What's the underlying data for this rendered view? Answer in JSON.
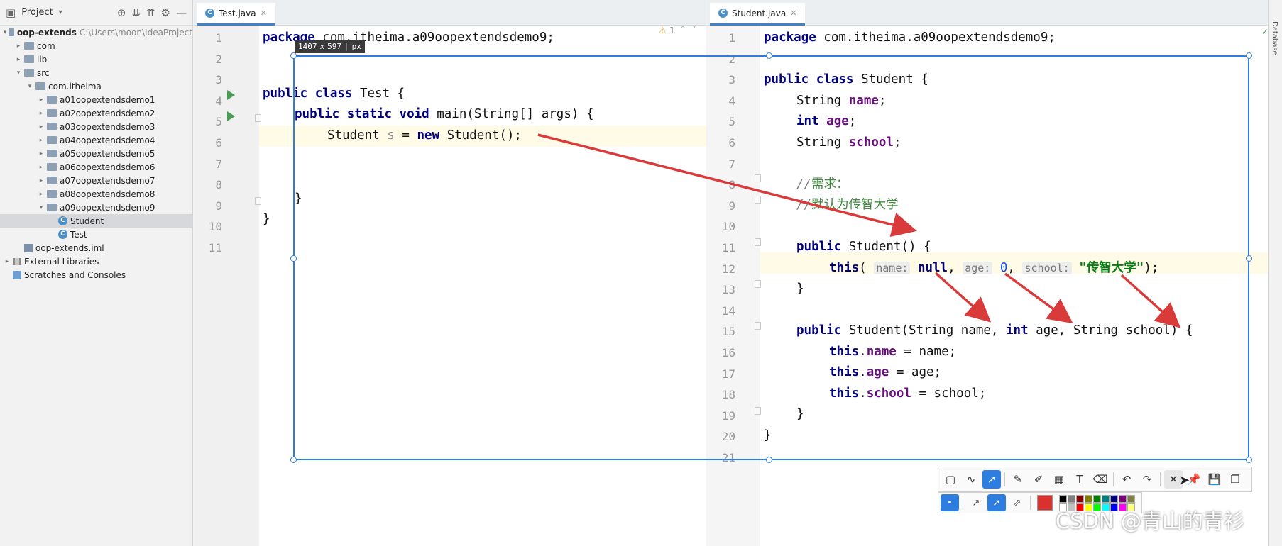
{
  "project": {
    "header_label": "Project",
    "tree": [
      {
        "label": "oop-extends",
        "path": "C:\\Users\\moon\\IdeaProject",
        "kind": "module",
        "depth": 0,
        "expanded": true,
        "bold": true
      },
      {
        "label": "com",
        "kind": "folder",
        "depth": 1,
        "expanded": false
      },
      {
        "label": "lib",
        "kind": "folder",
        "depth": 1,
        "expanded": false
      },
      {
        "label": "src",
        "kind": "folder",
        "depth": 1,
        "expanded": true
      },
      {
        "label": "com.itheima",
        "kind": "folder",
        "depth": 2,
        "expanded": true
      },
      {
        "label": "a01oopextendsdemo1",
        "kind": "folder",
        "depth": 3,
        "expanded": false
      },
      {
        "label": "a02oopextendsdemo2",
        "kind": "folder",
        "depth": 3,
        "expanded": false
      },
      {
        "label": "a03oopextendsdemo3",
        "kind": "folder",
        "depth": 3,
        "expanded": false
      },
      {
        "label": "a04oopextendsdemo4",
        "kind": "folder",
        "depth": 3,
        "expanded": false
      },
      {
        "label": "a05oopextendsdemo5",
        "kind": "folder",
        "depth": 3,
        "expanded": false
      },
      {
        "label": "a06oopextendsdemo6",
        "kind": "folder",
        "depth": 3,
        "expanded": false
      },
      {
        "label": "a07oopextendsdemo7",
        "kind": "folder",
        "depth": 3,
        "expanded": false
      },
      {
        "label": "a08oopextendsdemo8",
        "kind": "folder",
        "depth": 3,
        "expanded": false
      },
      {
        "label": "a09oopextendsdemo9",
        "kind": "folder",
        "depth": 3,
        "expanded": true
      },
      {
        "label": "Student",
        "kind": "class",
        "depth": 4,
        "selected": true
      },
      {
        "label": "Test",
        "kind": "class",
        "depth": 4
      },
      {
        "label": "oop-extends.iml",
        "kind": "iml",
        "depth": 1
      },
      {
        "label": "External Libraries",
        "kind": "libs",
        "depth": 0,
        "expanded": false
      },
      {
        "label": "Scratches and Consoles",
        "kind": "scratch",
        "depth": 0
      }
    ]
  },
  "left_editor": {
    "tab": "Test.java",
    "warning_count": "1",
    "line_numbers": [
      "1",
      "2",
      "3",
      "4",
      "5",
      "6",
      "7",
      "8",
      "9",
      "10",
      "11"
    ]
  },
  "right_editor": {
    "tab": "Student.java",
    "line_numbers": [
      "1",
      "2",
      "3",
      "4",
      "5",
      "6",
      "7",
      "8",
      "9",
      "10",
      "11",
      "12",
      "13",
      "14",
      "15",
      "16",
      "17",
      "18",
      "19",
      "20",
      "21"
    ]
  },
  "code_text": {
    "package_kw": "package",
    "package_name": " com.itheima.a09oopextendsdemo9;",
    "public": "public",
    "class": "class",
    "static": "static",
    "void": "void",
    "test_class": " Test {",
    "main_sig": " main(String[] args) {",
    "student_type": "Student ",
    "var_s": "s",
    "assign": " = ",
    "new": "new",
    "ctor_call": " Student();",
    "close_brace": "}",
    "student_class": " Student {",
    "string_type": "String ",
    "int": "int",
    "name": "name",
    "age": "age",
    "school": "school",
    "semi": ";",
    "comment1_slashes": "//",
    "comment1_text": "需求：",
    "comment2_slashes": "//",
    "comment2_text": "默认为传智大学",
    "ctor_noarg": " Student() {",
    "this": "this",
    "paren_open": "(",
    "hint_name": "name:",
    "null": "null",
    "comma": ", ",
    "hint_age": "age:",
    "zero": "0",
    "hint_school": "school:",
    "school_value": "\"传智大学\"",
    "paren_close_semi": ");",
    "ctor_full_a": " Student(String name, ",
    "ctor_full_b": " age, String school) {",
    "dot": ".",
    "assign_name": " = name;",
    "assign_age": " = age;",
    "assign_school": " = school;"
  },
  "capture": {
    "width_px": "1407",
    "x": "x",
    "height_px": "597",
    "unit": "px"
  },
  "toolbar": {
    "tools": [
      "rect-select-icon",
      "freehand-icon",
      "arrow-icon",
      "pen-icon",
      "marker-icon",
      "mosaic-icon",
      "text-icon",
      "eraser-icon",
      "undo-icon",
      "redo-icon",
      "close-icon",
      "pin-icon",
      "save-icon",
      "copy-icon"
    ],
    "active_tool": "arrow-icon",
    "main_color": "#d93030",
    "palette": [
      "#000000",
      "#808080",
      "#800000",
      "#808000",
      "#008000",
      "#008080",
      "#000080",
      "#800080",
      "#808040",
      "#ffffff",
      "#c0c0c0",
      "#ff0000",
      "#ffff00",
      "#00ff00",
      "#00ffff",
      "#0000ff",
      "#ff00ff",
      "#ffff80"
    ]
  },
  "watermark": "CSDN @青山的青衫",
  "side_strip_label": "Database",
  "colors": {
    "keyword": "#000080",
    "field": "#660e7a",
    "string": "#067d17",
    "number": "#1750eb",
    "annotation_arrow": "#d93a3a",
    "selection_border": "#2e7de1"
  }
}
